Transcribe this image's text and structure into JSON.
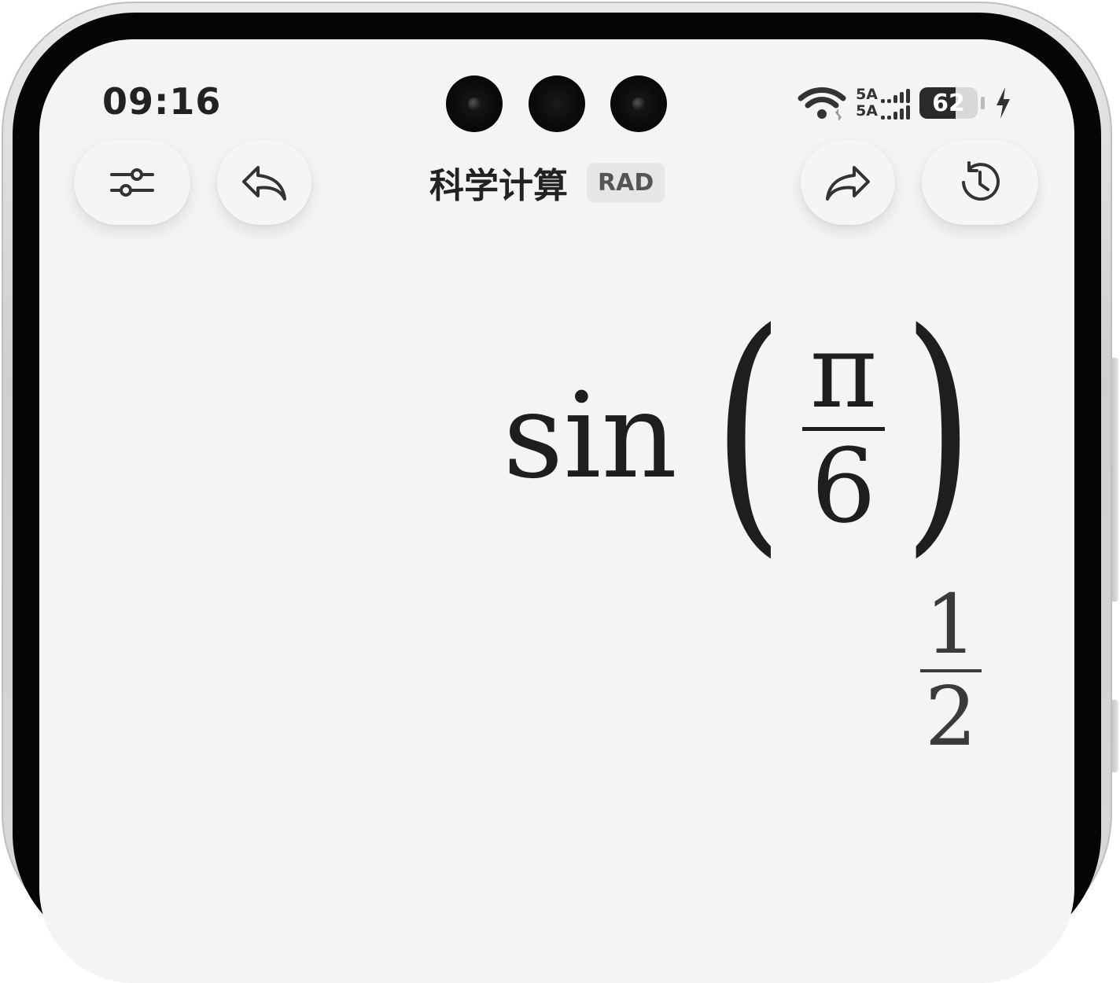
{
  "status_bar": {
    "time": "09:16",
    "network_1": "5A",
    "network_2": "5A",
    "battery": "62",
    "battery_level_percent": 62,
    "icons": [
      "wifi-icon",
      "signal-icon",
      "battery-icon",
      "charging-icon"
    ]
  },
  "toolbar": {
    "title": "科学计算",
    "angle_mode": "RAD",
    "icons": {
      "settings": "sliders-icon",
      "undo": "undo-icon",
      "redo": "redo-icon",
      "history": "history-icon"
    }
  },
  "display": {
    "expression": {
      "function": "sin",
      "numerator": "π",
      "denominator": "6"
    },
    "result": {
      "numerator": "1",
      "denominator": "2"
    }
  },
  "colors": {
    "screen_background": "#f3f4f6",
    "text": "#1e1e1e",
    "badge_background": "#e5e6e8"
  }
}
